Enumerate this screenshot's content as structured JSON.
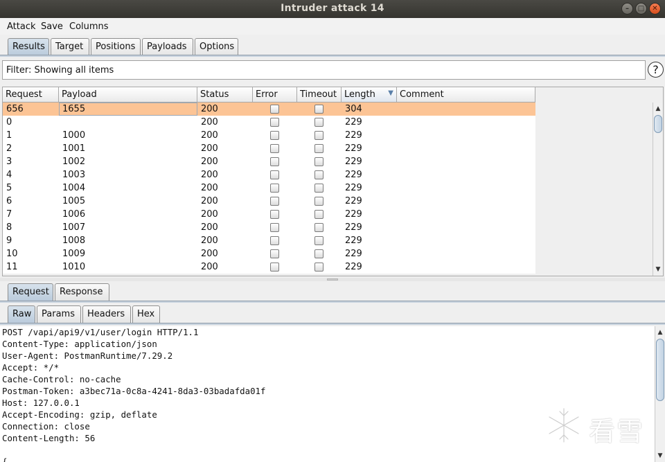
{
  "window": {
    "title": "Intruder attack 14"
  },
  "menu": [
    "Attack",
    "Save",
    "Columns"
  ],
  "tabs": [
    "Results",
    "Target",
    "Positions",
    "Payloads",
    "Options"
  ],
  "filter": {
    "text": "Filter: Showing all items",
    "help": "?"
  },
  "results": {
    "columns": [
      "Request",
      "Payload",
      "Status",
      "Error",
      "Timeout",
      "Length",
      "Comment"
    ],
    "sort_column": "Length",
    "rows": [
      {
        "request": "656",
        "payload": "1655",
        "status": "200",
        "error": false,
        "timeout": false,
        "length": "304",
        "comment": "",
        "selected": true
      },
      {
        "request": "0",
        "payload": "",
        "status": "200",
        "error": false,
        "timeout": false,
        "length": "229",
        "comment": ""
      },
      {
        "request": "1",
        "payload": "1000",
        "status": "200",
        "error": false,
        "timeout": false,
        "length": "229",
        "comment": ""
      },
      {
        "request": "2",
        "payload": "1001",
        "status": "200",
        "error": false,
        "timeout": false,
        "length": "229",
        "comment": ""
      },
      {
        "request": "3",
        "payload": "1002",
        "status": "200",
        "error": false,
        "timeout": false,
        "length": "229",
        "comment": ""
      },
      {
        "request": "4",
        "payload": "1003",
        "status": "200",
        "error": false,
        "timeout": false,
        "length": "229",
        "comment": ""
      },
      {
        "request": "5",
        "payload": "1004",
        "status": "200",
        "error": false,
        "timeout": false,
        "length": "229",
        "comment": ""
      },
      {
        "request": "6",
        "payload": "1005",
        "status": "200",
        "error": false,
        "timeout": false,
        "length": "229",
        "comment": ""
      },
      {
        "request": "7",
        "payload": "1006",
        "status": "200",
        "error": false,
        "timeout": false,
        "length": "229",
        "comment": ""
      },
      {
        "request": "8",
        "payload": "1007",
        "status": "200",
        "error": false,
        "timeout": false,
        "length": "229",
        "comment": ""
      },
      {
        "request": "9",
        "payload": "1008",
        "status": "200",
        "error": false,
        "timeout": false,
        "length": "229",
        "comment": ""
      },
      {
        "request": "10",
        "payload": "1009",
        "status": "200",
        "error": false,
        "timeout": false,
        "length": "229",
        "comment": ""
      },
      {
        "request": "11",
        "payload": "1010",
        "status": "200",
        "error": false,
        "timeout": false,
        "length": "229",
        "comment": ""
      }
    ]
  },
  "message_tabs": [
    "Request",
    "Response"
  ],
  "view_tabs": [
    "Raw",
    "Params",
    "Headers",
    "Hex"
  ],
  "request_lines": [
    "POST /vapi/api9/v1/user/login HTTP/1.1",
    "Content-Type: application/json",
    "User-Agent: PostmanRuntime/7.29.2",
    "Accept: */*",
    "Cache-Control: no-cache",
    "Postman-Token: a3bec71a-0c8a-4241-8da3-03badafda01f",
    "Host: 127.0.0.1",
    "Accept-Encoding: gzip, deflate",
    "Connection: close",
    "Content-Length: 56",
    "",
    "{"
  ],
  "watermark": {
    "text": "看雪"
  },
  "colors": {
    "selected_row": "#fcc495",
    "active_tab": "#c6d4e2",
    "titlebar": "#3c3b37",
    "close_button": "#e8622f"
  },
  "icons": [
    "minimize-icon",
    "maximize-icon",
    "close-icon",
    "help-icon",
    "sort-desc-icon",
    "snowflake-icon"
  ]
}
